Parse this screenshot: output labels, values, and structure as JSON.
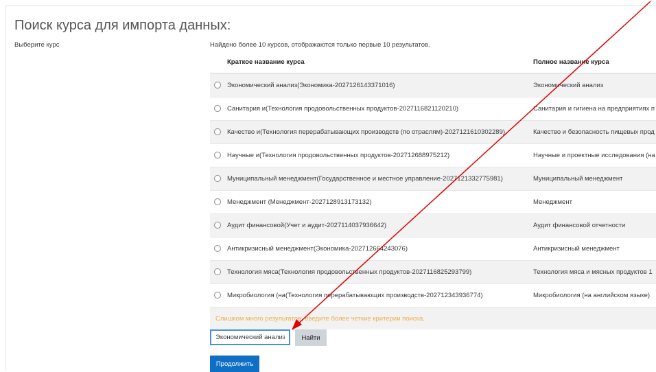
{
  "page": {
    "title": "Поиск курса для импорта данных:",
    "select_label": "Выберите курс",
    "found_text": "Найдено более 10 курсов, отображаются только первые 10 результатов."
  },
  "table": {
    "headers": {
      "short": "Краткое название курса",
      "full": "Полное название курса"
    },
    "rows": [
      {
        "short": "Экономический анализ(Экономика-2027126143371016)",
        "full": "Экономический анализ"
      },
      {
        "short": "Санитария и(Технология продовольственных продуктов-2027116821120210)",
        "full": "Санитария и гигиена на предприятиях п"
      },
      {
        "short": "Качество и(Технология перерабатывающих производств (по отраслям)-2027121610302289)",
        "full": "Качество и безопасность пищевых прод"
      },
      {
        "short": "Научные и(Технология продовольственных продуктов-202712688975212)",
        "full": "Научные и проектные исследования (на"
      },
      {
        "short": "Муниципальный менеджмент(Государственное и местное управление-2027121332775981)",
        "full": "Муниципальный менеджмент"
      },
      {
        "short": "Менеджмент (Менеджмент-2027128913173132)",
        "full": "Менеджмент"
      },
      {
        "short": "Аудит финансовой(Учет и аудит-2027114037936642)",
        "full": "Аудит финансовой отчетности"
      },
      {
        "short": "Антикризисный менеджмент(Экономика-202712664243076)",
        "full": "Антикризисный менеджмент"
      },
      {
        "short": "Технология мяса(Технология продовольственных продуктов-2027116825293799)",
        "full": "Технология мяса и мясных продуктов 1"
      },
      {
        "short": "Микробиология (на(Технология перерабатывающих производств-202712343936774)",
        "full": "Микробиология (на английском языке)"
      }
    ],
    "warning": "Слишком много результатов, введите более четкие критерии поиска."
  },
  "search": {
    "value": "Экономический анализ("
  },
  "buttons": {
    "search": "Найти",
    "continue": "Продолжить"
  },
  "colors": {
    "annotation_arrow": "#e00000",
    "primary": "#0f6fc5",
    "warning": "#f0ad4e",
    "input_focus": "#4a90d9"
  }
}
